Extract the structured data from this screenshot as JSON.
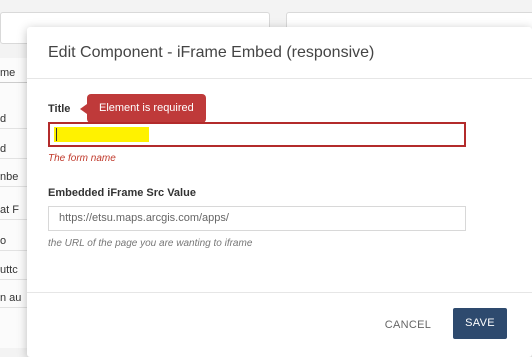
{
  "background": {
    "list_items": [
      "me",
      "d",
      "d",
      "nbe",
      "at F",
      "o",
      "uttc",
      "n au"
    ]
  },
  "modal": {
    "title": "Edit Component - iFrame Embed (responsive)",
    "fields": {
      "title": {
        "label": "Title",
        "value": "",
        "error_tooltip": "Element is required",
        "help": "The form name"
      },
      "src": {
        "label": "Embedded iFrame Src Value",
        "value": "https://etsu.maps.arcgis.com/apps/",
        "help": "the URL of the page you are wanting to iframe"
      }
    },
    "buttons": {
      "cancel": "CANCEL",
      "save": "SAVE"
    }
  },
  "colors": {
    "error": "#bf3a3a",
    "primary_button": "#2e4a6e",
    "highlight": "#fff200"
  }
}
